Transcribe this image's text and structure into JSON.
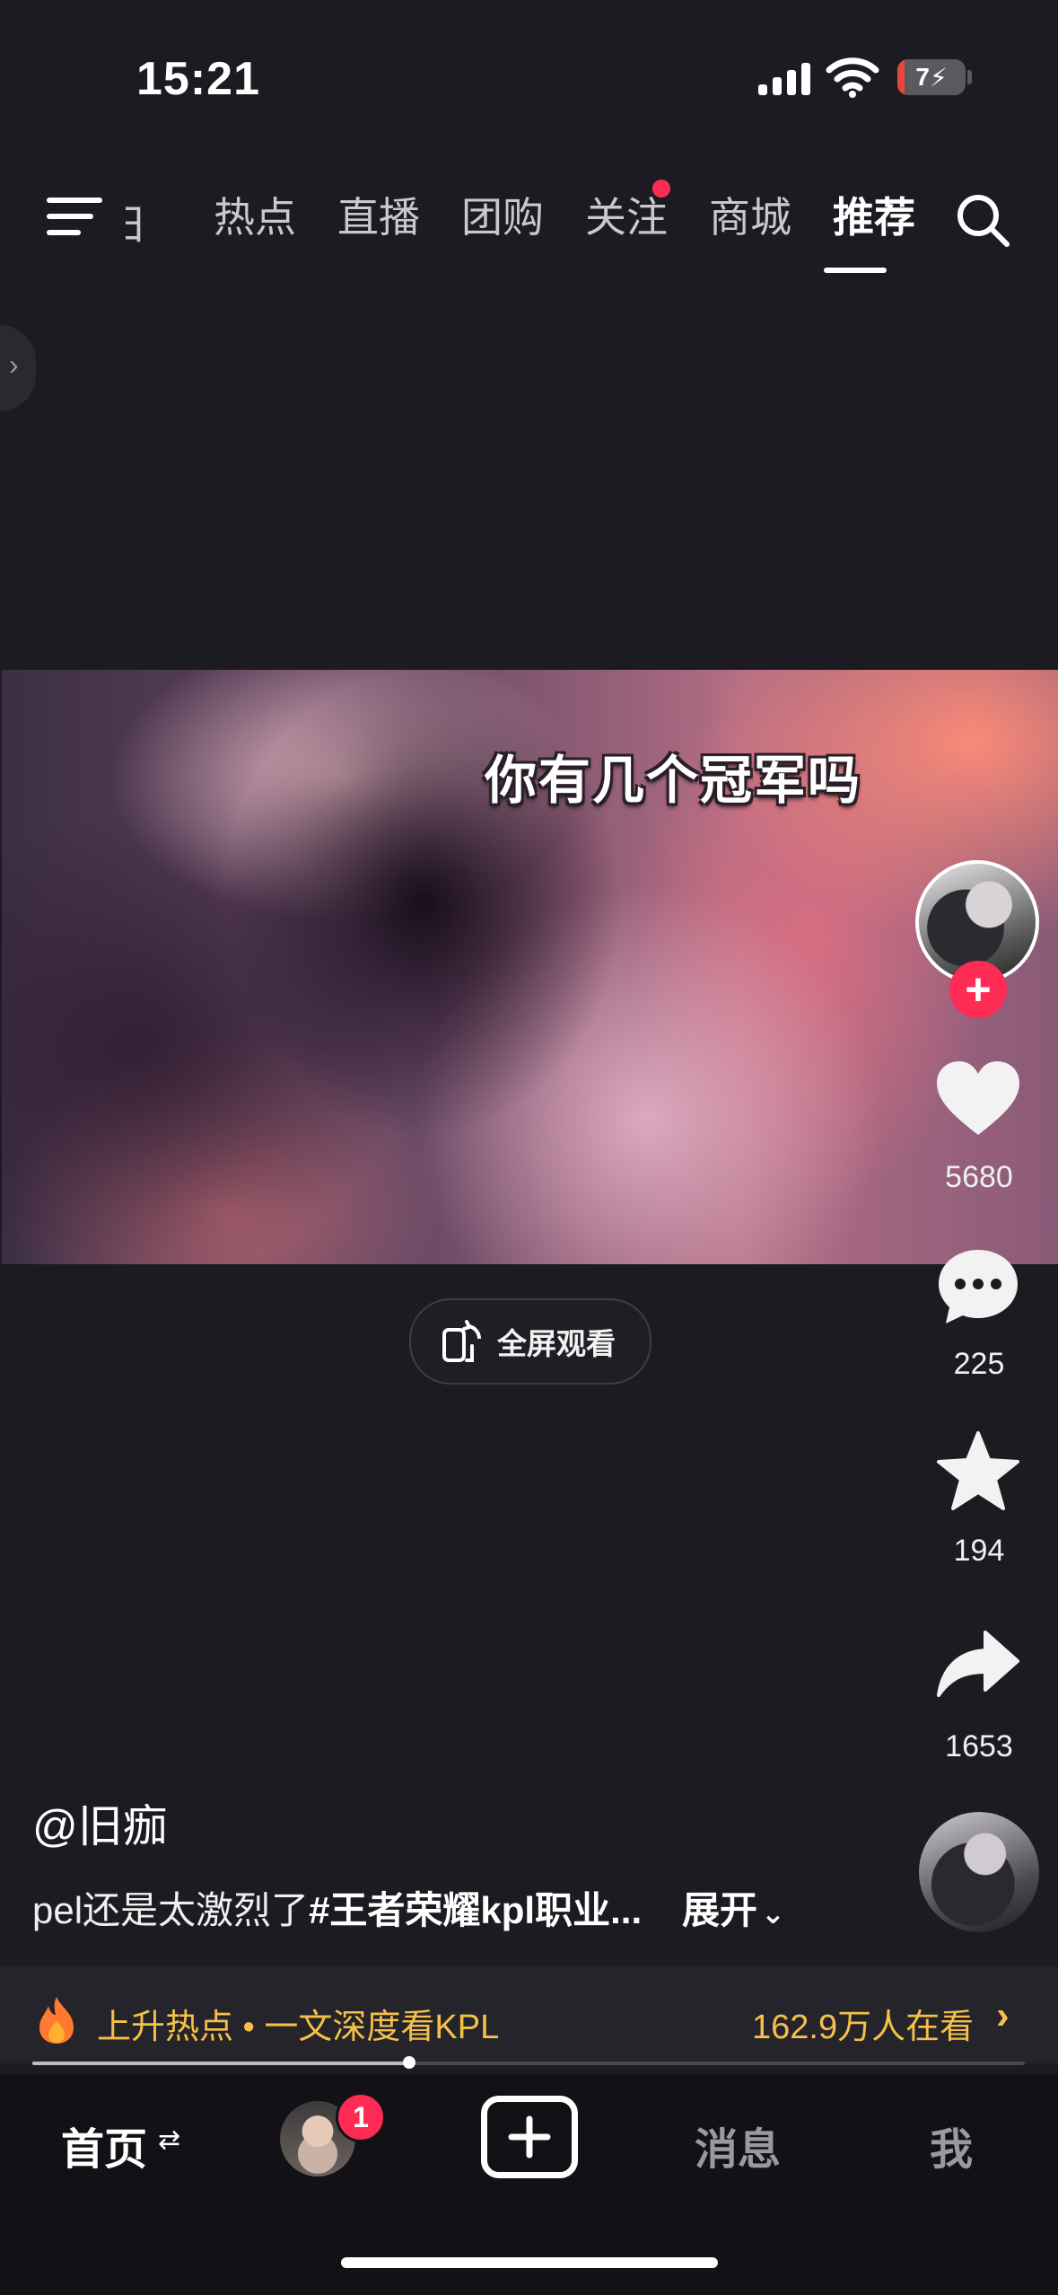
{
  "status_bar": {
    "time": "15:21",
    "battery": "7"
  },
  "top_nav": {
    "partial_tab": "日",
    "tabs": [
      "热点",
      "直播",
      "团购",
      "关注",
      "商城",
      "推荐"
    ],
    "active_tab": "推荐",
    "unread_dot_on": "关注"
  },
  "video": {
    "caption": "你有几个冠军吗",
    "fullscreen_label": "全屏观看"
  },
  "actions": {
    "likes": "5680",
    "comments": "225",
    "favorites": "194",
    "shares": "1653"
  },
  "post": {
    "author": "@旧痂",
    "description_prefix": "pel还是太激烈了",
    "description_tag": "#王者荣耀kpl职业...",
    "expand_label": "展开"
  },
  "hot_bar": {
    "label": "上升热点 • 一文深度看KPL",
    "viewers": "162.9万人在看"
  },
  "progress": 0.38,
  "tab_bar": {
    "home": "首页",
    "friends_badge": "1",
    "messages": "消息",
    "me": "我"
  },
  "colors": {
    "accent": "#fe2c55",
    "hot": "#f4c04a",
    "background": "#1c1b21"
  }
}
